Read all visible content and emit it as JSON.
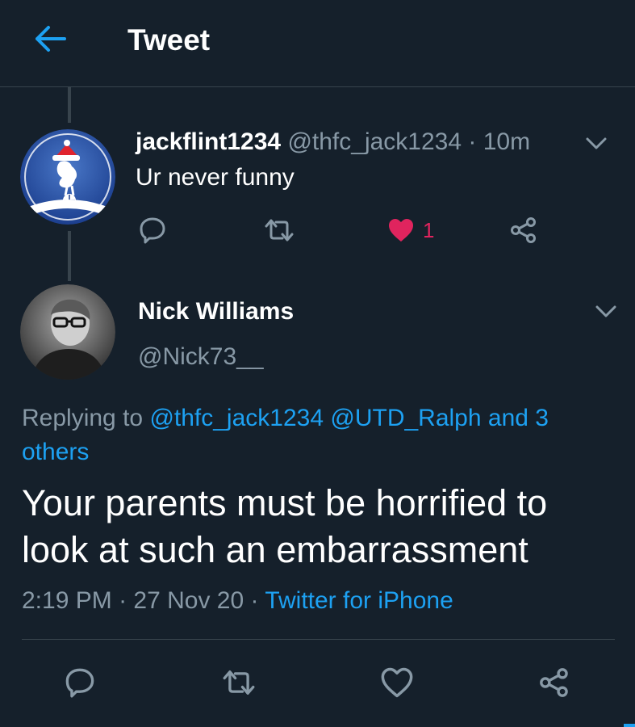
{
  "header": {
    "title": "Tweet"
  },
  "reply_tweet": {
    "name": "jackflint1234",
    "handle": "@thfc_jack1234",
    "separator": "·",
    "time": "10m",
    "text": "Ur never funny",
    "like_count": "1",
    "avatar_badge": "TOTTENHAM"
  },
  "main_tweet": {
    "name": "Nick Williams",
    "handle": "@Nick73__",
    "replying_prefix": "Replying to",
    "replying_mention_1": "@thfc_jack1234",
    "replying_mention_2": "@UTD_Ralph",
    "replying_others": "and 3 others",
    "text": "Your parents must be horrified to look at such an embarrassment",
    "time": "2:19 PM",
    "date": "27 Nov 20",
    "source": "Twitter for iPhone"
  },
  "colors": {
    "background": "#15202b",
    "accent": "#1da1f2",
    "secondary_text": "#8899a6",
    "like": "#e0245e",
    "border": "#38444d"
  },
  "icons": [
    "back-arrow-icon",
    "chevron-down-icon",
    "reply-icon",
    "retweet-icon",
    "like-icon",
    "share-icon"
  ]
}
